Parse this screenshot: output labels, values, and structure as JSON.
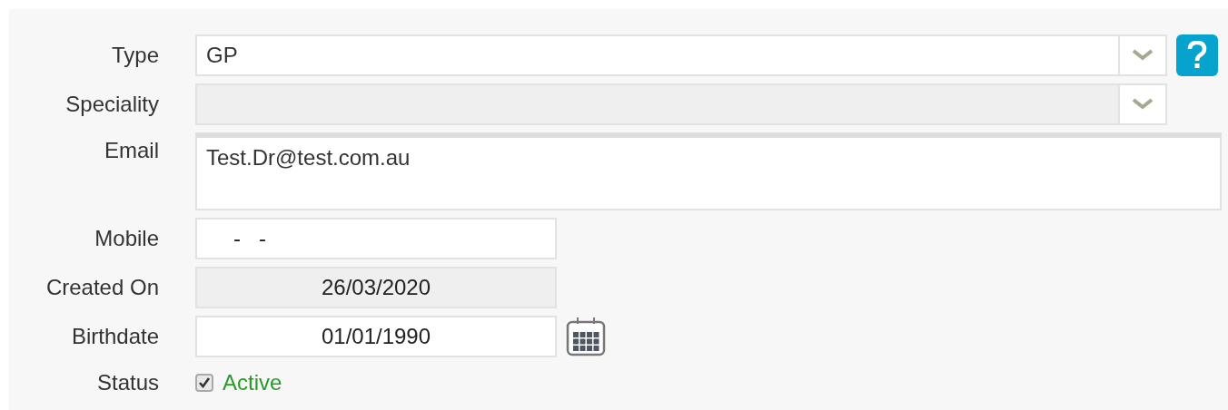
{
  "fields": [
    {
      "label": "Type",
      "kind": "select",
      "value": "GP",
      "disabled": false,
      "help": true
    },
    {
      "label": "Speciality",
      "kind": "select",
      "disabled": true
    },
    {
      "label": "Email",
      "kind": "textarea",
      "value": "Test.Dr@test.com.au"
    },
    {
      "label": "Mobile",
      "kind": "text",
      "value": "-   -",
      "disabled": false
    },
    {
      "label": "Created On",
      "kind": "text",
      "value": "26/03/2020",
      "disabled": true
    },
    {
      "label": "Birthdate",
      "kind": "text",
      "value": "01/01/1990",
      "disabled": false,
      "calendar": true
    },
    {
      "label": "Status",
      "kind": "checkbox",
      "text": "Active",
      "checked": true
    }
  ]
}
